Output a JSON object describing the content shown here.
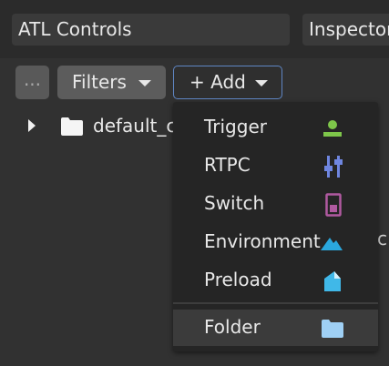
{
  "tabs": [
    {
      "label": "ATL Controls"
    },
    {
      "label": "Inspector"
    }
  ],
  "toolbar": {
    "more_label": "...",
    "filters_label": "Filters",
    "add_label": "+ Add"
  },
  "tree": {
    "root_label": "default_c"
  },
  "side_text": "c",
  "menu": {
    "items": [
      {
        "label": "Trigger",
        "icon": "trigger-icon",
        "color": "#7ec64a"
      },
      {
        "label": "RTPC",
        "icon": "rtpc-icon",
        "color": "#6f86e0"
      },
      {
        "label": "Switch",
        "icon": "switch-icon",
        "color": "#b05aa0"
      },
      {
        "label": "Environment",
        "icon": "environment-icon",
        "color": "#2aa7dd"
      },
      {
        "label": "Preload",
        "icon": "preload-icon",
        "color": "#40b8e8"
      }
    ],
    "folder": {
      "label": "Folder",
      "icon": "folder-icon",
      "color": "#9fd0f5"
    }
  },
  "colors": {
    "background": "#313131",
    "accent_border": "#5f86c4"
  }
}
